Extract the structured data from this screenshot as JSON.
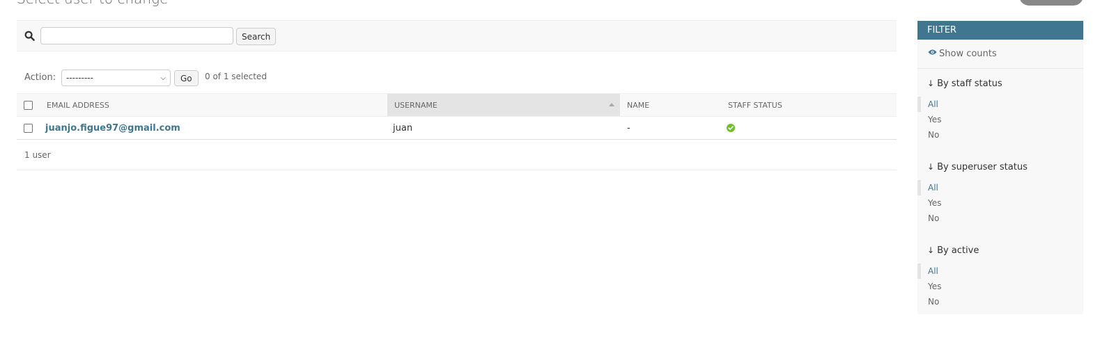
{
  "page": {
    "title": "Select user to change"
  },
  "search": {
    "button_label": "Search",
    "value": ""
  },
  "actions": {
    "label": "Action:",
    "selected_option": "---------",
    "go_label": "Go",
    "selected_count": "0 of 1 selected"
  },
  "table": {
    "columns": [
      "Email address",
      "Username",
      "Name",
      "Staff status"
    ],
    "rows": [
      {
        "email": "juanjo.figue97@gmail.com",
        "username": "juan",
        "name": "-",
        "staff_status": "check-icon"
      }
    ]
  },
  "paginator": {
    "text": "1 user"
  },
  "filter": {
    "header": "Filter",
    "show_counts": "Show counts",
    "groups": [
      {
        "title": "By staff status",
        "options": [
          "All",
          "Yes",
          "No"
        ],
        "selected": "All"
      },
      {
        "title": "By superuser status",
        "options": [
          "All",
          "Yes",
          "No"
        ],
        "selected": "All"
      },
      {
        "title": "By active",
        "options": [
          "All",
          "Yes",
          "No"
        ],
        "selected": "All"
      }
    ]
  },
  "colors": {
    "accent": "#417690",
    "success": "#70bf2b"
  },
  "icons": {
    "search": "search-icon",
    "eye": "eye-icon",
    "arrow": "arrow-down-icon",
    "sort": "sort-ascending-icon"
  }
}
